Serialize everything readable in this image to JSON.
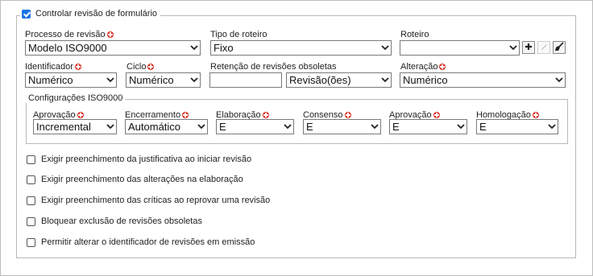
{
  "header": {
    "checkbox_label": "Controlar revisão de formulário",
    "checked": true
  },
  "row1": {
    "processo": {
      "label": "Processo de revisão",
      "value": "Modelo ISO9000"
    },
    "tipo": {
      "label": "Tipo de roteiro",
      "value": "Fixo"
    },
    "roteiro": {
      "label": "Roteiro",
      "value": ""
    }
  },
  "row2": {
    "identificador": {
      "label": "Identificador",
      "value": "Numérico"
    },
    "ciclo": {
      "label": "Ciclo",
      "value": "Numérico"
    },
    "retencao": {
      "label": "Retenção de revisões obsoletas",
      "input_value": "",
      "unit": "Revisão(ões)"
    },
    "alteracao": {
      "label": "Alteração",
      "value": "Numérico"
    }
  },
  "config": {
    "legend": "Configurações ISO9000",
    "fields": [
      {
        "label": "Aprovação",
        "value": "Incremental"
      },
      {
        "label": "Encerramento",
        "value": "Automático"
      },
      {
        "label": "Elaboração",
        "value": "E"
      },
      {
        "label": "Consenso",
        "value": "E"
      },
      {
        "label": "Aprovação",
        "value": "E"
      },
      {
        "label": "Homologação",
        "value": "E"
      }
    ]
  },
  "options": [
    {
      "label": "Exigir preenchimento da justificativa ao iniciar revisão",
      "checked": false
    },
    {
      "label": "Exigir preenchimento das alterações na elaboração",
      "checked": false
    },
    {
      "label": "Exigir preenchimento das críticas ao reprovar uma revisão",
      "checked": false
    },
    {
      "label": "Bloquear exclusão de revisões obsoletas",
      "checked": false
    },
    {
      "label": "Permitir alterar o identificador de revisões em emissão",
      "checked": false
    }
  ],
  "icons": {
    "required": "required-icon",
    "add": "plus-icon",
    "edit": "pencil-icon",
    "clear": "broom-icon",
    "dropdown": "chevron-down-icon"
  },
  "colors": {
    "checkbox_checked": "#1a73e8",
    "required": "#d93025"
  }
}
